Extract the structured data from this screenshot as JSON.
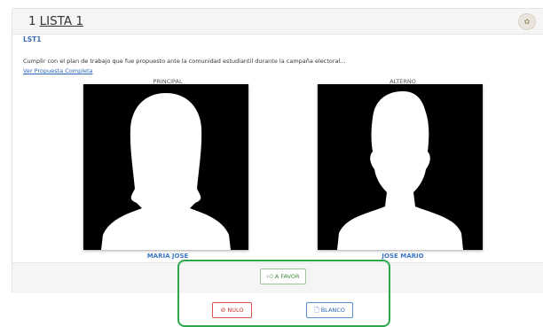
{
  "list": {
    "number": "1",
    "name": "LISTA 1",
    "code": "LST1",
    "proposal": "Cumplir con el plan de trabajo que fue propuesto ante la comunidad estudiantil durante la campaña electoral...",
    "see_more": "Ver Propuesta Completa"
  },
  "candidates": {
    "principal": {
      "role": "PRINCIPAL",
      "name": "MARIA JOSE",
      "avatar": "female-silhouette-icon"
    },
    "alterno": {
      "role": "ALTERNO",
      "name": "JOSE MARIO",
      "avatar": "male-silhouette-icon"
    }
  },
  "actions": {
    "favor_label": "A FAVOR",
    "favor_icon": "thumbs-up-icon",
    "nulo_label": "NULO",
    "nulo_icon": "ban-icon",
    "blanco_label": "BLANCO",
    "blanco_icon": "file-icon"
  },
  "colors": {
    "accent_blue": "#3c78c3",
    "favor_green": "#3e8a3a",
    "nulo_red": "#c9302c",
    "highlight_green": "#2aa84a"
  }
}
